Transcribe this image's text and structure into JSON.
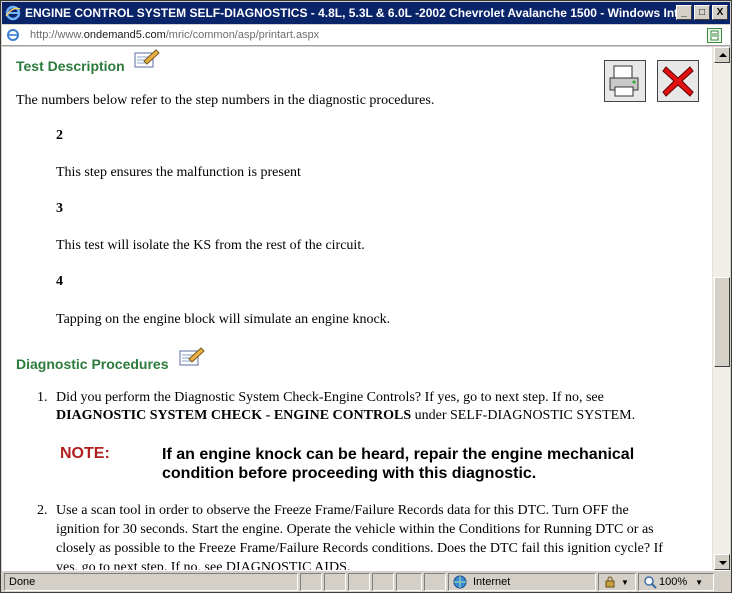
{
  "window": {
    "title": "ENGINE CONTROL SYSTEM SELF-DIAGNOSTICS - 4.8L, 5.3L & 6.0L -2002 Chevrolet Avalanche 1500 - Windows Intern...",
    "minimize": "_",
    "maximize": "□",
    "close": "X"
  },
  "address": {
    "url_prefix": "http://www.",
    "url_domain": "ondemand5.com",
    "url_path": "/mric/common/asp/printart.aspx"
  },
  "test_description": {
    "heading": "Test Description",
    "intro": "The numbers below refer to the step numbers in the diagnostic procedures.",
    "steps": [
      {
        "num": "2",
        "text": "This step ensures the malfunction is present"
      },
      {
        "num": "3",
        "text": "This test will isolate the KS from the rest of the circuit."
      },
      {
        "num": "4",
        "text": "Tapping on the engine block will simulate an engine knock."
      }
    ]
  },
  "diagnostic_procedures": {
    "heading": "Diagnostic Procedures",
    "items": [
      {
        "num": "1.",
        "line1": "Did you perform the Diagnostic System Check-Engine Controls? If yes, go to next step. If no, see",
        "bold": "DIAGNOSTIC SYSTEM CHECK - ENGINE CONTROLS",
        "tail": " under SELF-DIAGNOSTIC SYSTEM."
      },
      {
        "num": "2.",
        "line1": "Use a scan tool in order to observe the Freeze Frame/Failure Records data for this DTC. Turn OFF the",
        "line2": "ignition for 30 seconds. Start the engine. Operate the vehicle within the Conditions for Running DTC or as",
        "line3": "closely as possible to the Freeze Frame/Failure Records conditions. Does the DTC fail this ignition cycle? If",
        "line4": "yes, go to next step. If no, see DIAGNOSTIC AIDS."
      }
    ],
    "note_label": "NOTE:",
    "note_line1": "If an engine knock can be heard, repair the engine mechanical",
    "note_line2": "condition before proceeding with this diagnostic."
  },
  "status": {
    "text": "Done",
    "zone": "Internet",
    "zoom": "100%"
  },
  "icons": {
    "print": "printer-icon",
    "close": "red-x-close-icon",
    "notepad": "notepad-pencil-icon"
  },
  "colors": {
    "heading_green": "#2c7b3c",
    "note_red": "#b02020",
    "titlebar": "#0a246a"
  }
}
